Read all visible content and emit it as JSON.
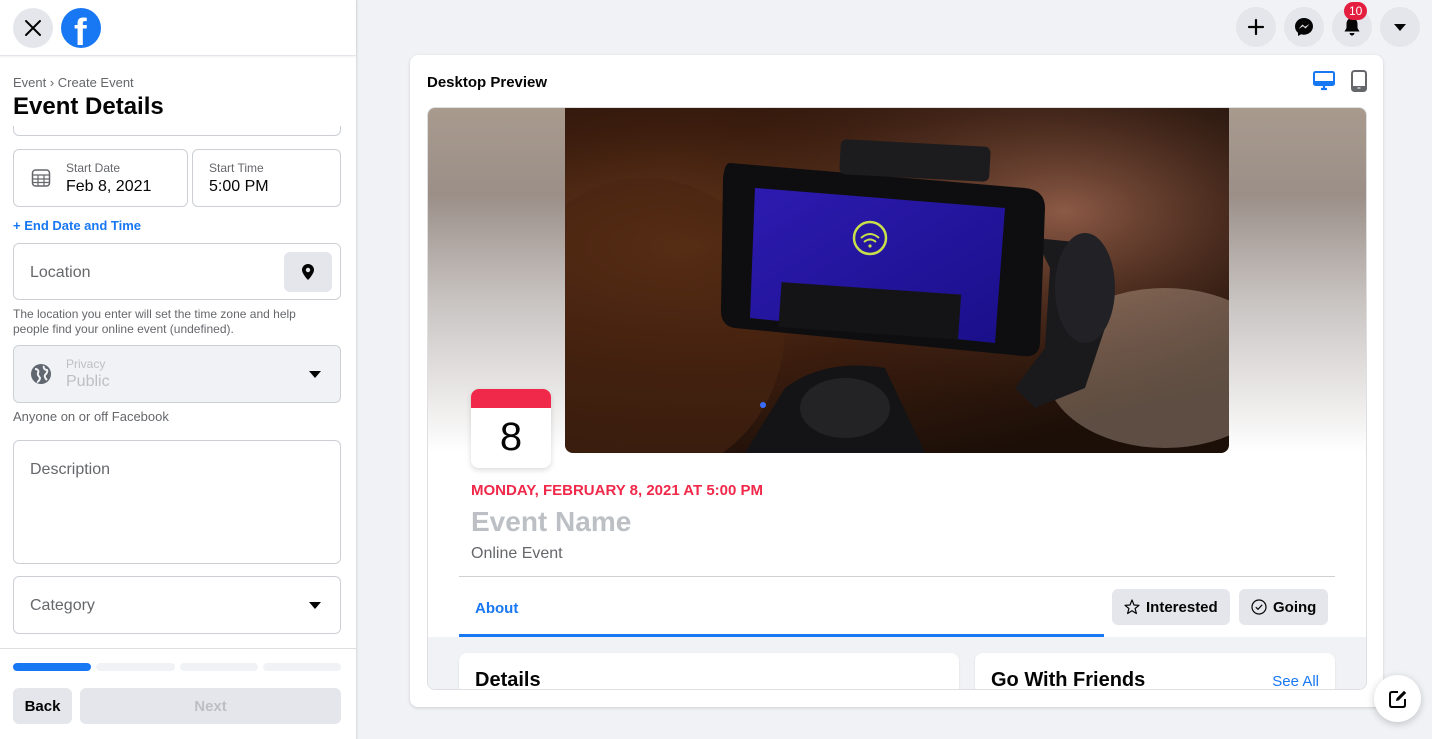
{
  "sidebar": {
    "close_icon": "close-icon",
    "logo": "facebook-logo",
    "breadcrumb": "Event › Create Event",
    "title": "Event Details",
    "start_date": {
      "label": "Start Date",
      "value": "Feb 8, 2021"
    },
    "start_time": {
      "label": "Start Time",
      "value": "5:00 PM"
    },
    "end_date_link": "+ End Date and Time",
    "location": {
      "placeholder": "Location",
      "help": "The location you enter will set the time zone and help people find your online event (undefined)."
    },
    "privacy": {
      "label": "Privacy",
      "value": "Public",
      "help": "Anyone on or off Facebook"
    },
    "description": {
      "placeholder": "Description"
    },
    "category": {
      "placeholder": "Category"
    },
    "progress": {
      "current_step": 1,
      "total_steps": 4
    },
    "back_label": "Back",
    "next_label": "Next"
  },
  "top_nav": {
    "create_icon": "plus-icon",
    "messenger_icon": "messenger-icon",
    "notifications_icon": "bell-icon",
    "notifications_count": "10",
    "account_icon": "caret-down-icon"
  },
  "preview": {
    "title": "Desktop Preview",
    "devices": [
      "desktop",
      "mobile"
    ],
    "active_device": "desktop",
    "calendar_day": "8",
    "event_date": "MONDAY, FEBRUARY 8, 2021 AT 5:00 PM",
    "event_name": "Event Name",
    "event_type": "Online Event",
    "tab_about": "About",
    "interested_label": "Interested",
    "going_label": "Going",
    "details_heading": "Details",
    "friends_heading": "Go With Friends",
    "see_all": "See All"
  },
  "colors": {
    "accent": "#1877f2",
    "event_red": "#f02849",
    "badge_red": "#e41e3f"
  }
}
